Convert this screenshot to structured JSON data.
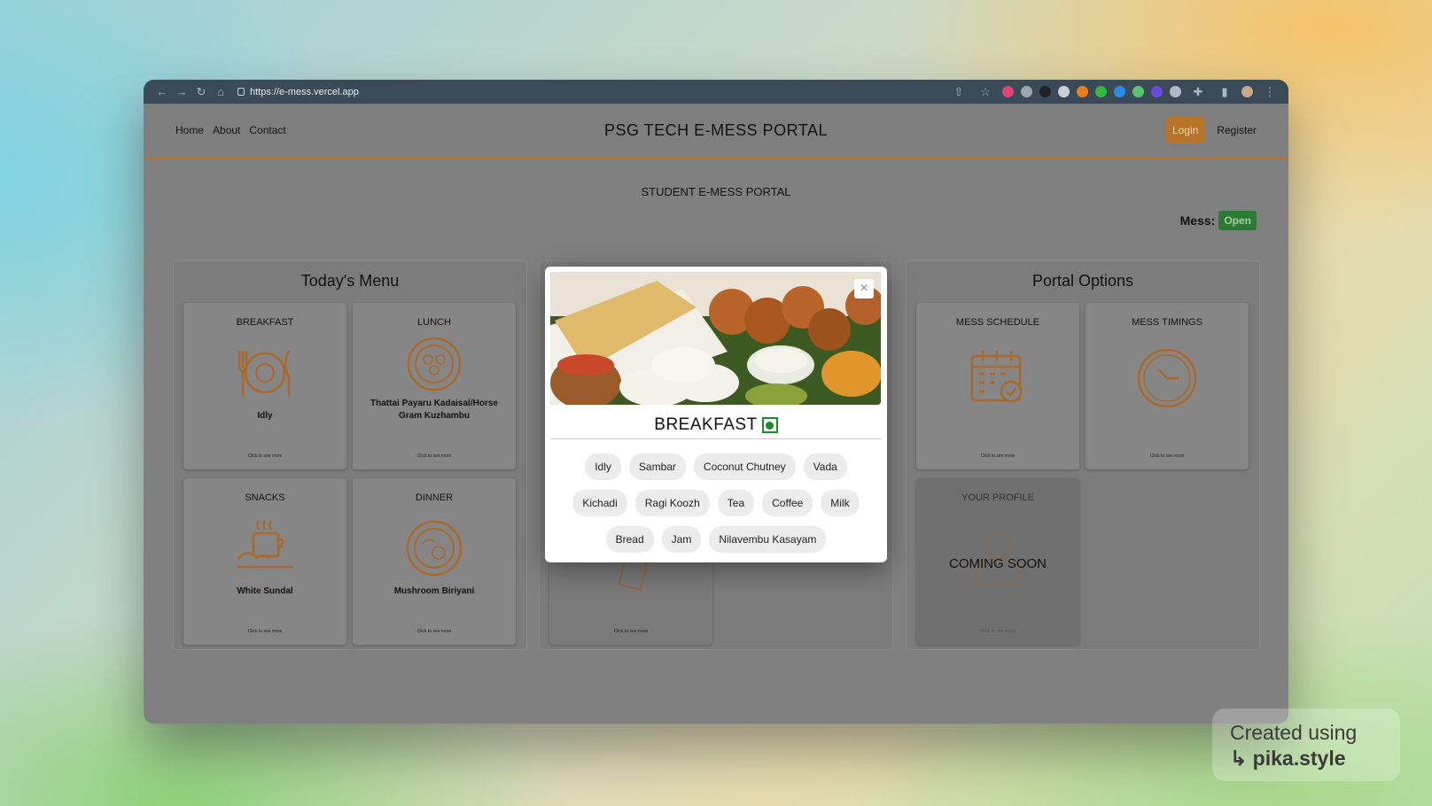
{
  "browser": {
    "url": "https://e-mess.vercel.app"
  },
  "nav": {
    "links": [
      "Home",
      "About",
      "Contact"
    ],
    "title": "PSG TECH E-MESS PORTAL",
    "login": "Login",
    "register": "Register"
  },
  "subtitle": "STUDENT E-MESS PORTAL",
  "mess_status": {
    "label": "Mess:",
    "value": "Open"
  },
  "todays_menu": {
    "title": "Today's Menu",
    "cards": [
      {
        "heading": "BREAKFAST",
        "item": "Idly",
        "more": "Click to see more",
        "icon": "breakfast-plate-icon"
      },
      {
        "heading": "LUNCH",
        "item": "Thattai Payaru Kadaisal/Horse Gram Kuzhambu",
        "more": "Click to see more",
        "icon": "lunch-plate-icon"
      },
      {
        "heading": "SNACKS",
        "item": "White Sundal",
        "more": "Click to see more",
        "icon": "tea-snack-icon"
      },
      {
        "heading": "DINNER",
        "item": "Mushroom Biriyani",
        "more": "Click to see more",
        "icon": "dinner-plate-icon"
      }
    ]
  },
  "portal_options": {
    "title": "Portal Options",
    "cards": [
      {
        "heading": "MESS SCHEDULE",
        "more": "Click to see more",
        "icon": "calendar-check-icon"
      },
      {
        "heading": "MESS TIMINGS",
        "more": "Click to see more",
        "icon": "clock-icon"
      },
      {
        "heading": "YOUR PROFILE",
        "overlay": "COMING SOON",
        "more": "Click to see more",
        "icon": "user-icon"
      }
    ]
  },
  "middle_card": {
    "more": "Click to see more"
  },
  "modal": {
    "title": "BREAKFAST",
    "close": "×",
    "items": [
      "Idly",
      "Sambar",
      "Coconut Chutney",
      "Vada",
      "Kichadi",
      "Ragi Koozh",
      "Tea",
      "Coffee",
      "Milk",
      "Bread",
      "Jam",
      "Nilavembu Kasayam"
    ]
  },
  "watermark": {
    "line1": "Created using",
    "line2": "pika.style"
  },
  "colors": {
    "accent": "#b8752a",
    "open": "#2a7c35",
    "veg": "#1a8a2a"
  }
}
